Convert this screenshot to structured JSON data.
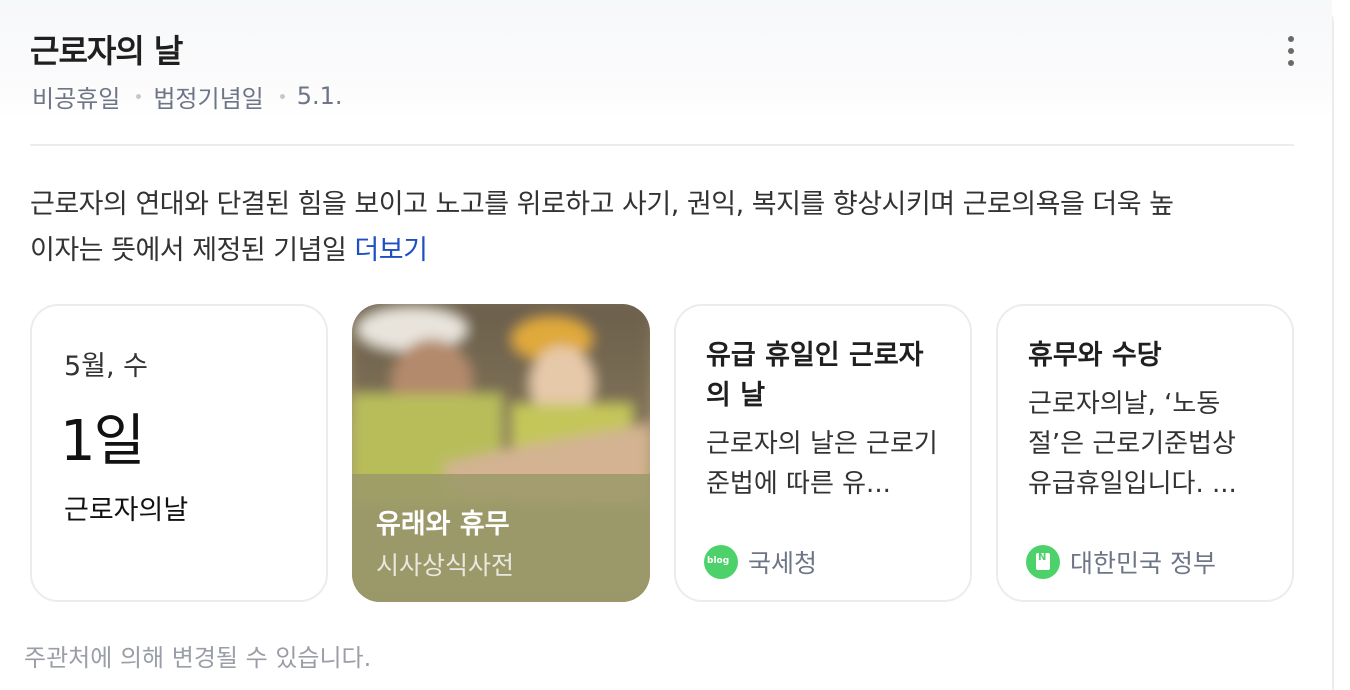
{
  "header": {
    "title": "근로자의 날",
    "meta": [
      "비공휴일",
      "법정기념일",
      "5.1."
    ]
  },
  "description": {
    "line1": "근로자의 연대와 단결된 힘을 보이고 노고를 위로하고 사기, 권익, 복지를 향상시키며 근로의욕을 더욱 높",
    "line2": "이자는 뜻에서 제정된 기념일",
    "more_link": "더보기"
  },
  "cards": {
    "date": {
      "month_day": "5월, 수",
      "day": "1일",
      "name": "근로자의날"
    },
    "photo": {
      "title": "유래와 휴무",
      "subtitle": "시사상식사전"
    },
    "article1": {
      "title": "유급 휴일인 근로자의 날",
      "text": "근로자의 날은 근로기준법에 따른 유...",
      "source": "국세청",
      "source_icon": "blog-icon"
    },
    "article2": {
      "title": "휴무와 수당",
      "text": "근로자의날, ‘노동절’은 근로기준법상 유급휴일입니다. ...",
      "source": "대한민국 정부",
      "source_icon": "naver-icon"
    }
  },
  "footer": {
    "note": "주관처에 의해 변경될 수 있습니다."
  },
  "colors": {
    "accent_link": "#1f4fc4",
    "source_badge": "#4dd16a",
    "photo_tint": "#9a9a62"
  }
}
